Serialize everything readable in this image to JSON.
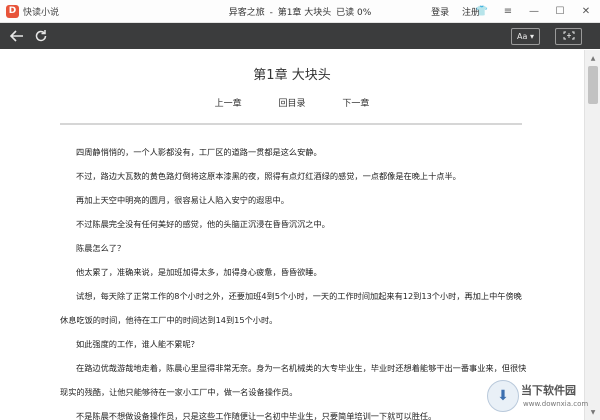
{
  "app": {
    "logo_text": "快读小说",
    "logo_mark": "D"
  },
  "window": {
    "book": "异客之旅",
    "sep": "-",
    "chapter": "第1章 大块头",
    "progress": "已读 0%",
    "login": "登录",
    "register": "注册"
  },
  "toolbar": {
    "font_label": "Aa ▾"
  },
  "chapter": {
    "title": "第1章  大块头",
    "prev": "上一章",
    "toc": "回目录",
    "next": "下一章"
  },
  "paragraphs": [
    "四周静悄悄的，一个人影都没有，工厂区的道路一贯都是这么安静。",
    "不过，路边大瓦数的黄色路灯倒将这原本漆黑的夜，照得有点灯红酒绿的感觉，一点都像是在晚上十点半。",
    "再加上天空中明亮的圆月，很容易让人陷入安宁的遐思中。",
    "不过陈晨完全没有任何美好的感觉，他的头脑正沉浸在昏昏沉沉之中。",
    "陈晨怎么了？",
    "他太累了，准确来说，是加班加得太多，加得身心疲惫，昏昏欲睡。",
    "试想，每天除了正常工作的8个小时之外，还要加班4到5个小时，一天的工作时间加起来有12到13个小时，再加上中午傍晚休息吃饭的时间，他待在工厂中的时间达到14到15个小时。",
    "如此强度的工作，谁人能不累呢？",
    "在路边优哉游哉地走着，陈晨心里显得非常无奈。身为一名机械类的大专毕业生，毕业时还想着能够干出一番事业来，但很快现实的残酷，让他只能够待在一家小工厂中，做一名设备操作员。",
    "不是陈晨不想做设备操作员，只是这些工作随便让一名初中毕业生，只要简单培训一下就可以胜任。"
  ],
  "watermark": {
    "title": "当下软件园",
    "url": "www.downxia.com"
  }
}
